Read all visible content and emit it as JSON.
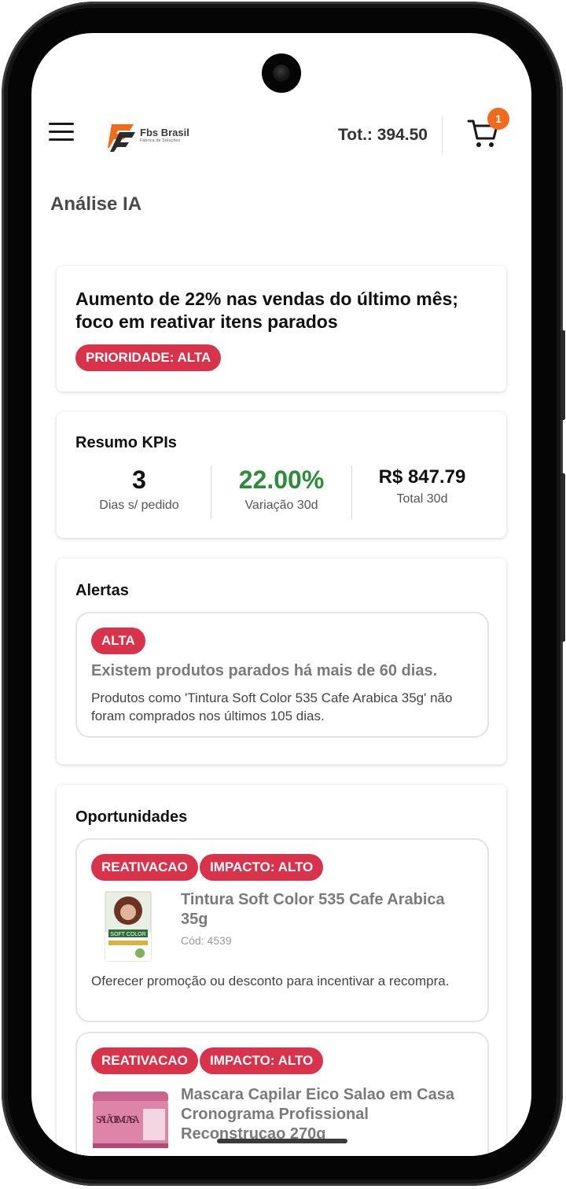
{
  "header": {
    "brand_name": "Fbs Brasil",
    "brand_tagline": "Fábrica de Soluções",
    "total_label": "Tot.: 394.50",
    "cart_badge": "1"
  },
  "page": {
    "title": "Análise IA"
  },
  "summary": {
    "headline": "Aumento de 22% nas vendas do último mês; foco em reativar itens parados",
    "priority_label": "PRIORIDADE: ALTA"
  },
  "kpis": {
    "title": "Resumo KPIs",
    "items": [
      {
        "value": "3",
        "label": "Dias s/ pedido"
      },
      {
        "value": "22.00%",
        "label": "Variação 30d"
      },
      {
        "value": "R$ 847.79",
        "label": "Total 30d"
      }
    ]
  },
  "alerts": {
    "title": "Alertas",
    "items": [
      {
        "badge": "ALTA",
        "title": "Existem produtos parados há mais de 60 dias.",
        "description": "Produtos como 'Tintura Soft Color 535 Cafe Arabica 35g' não foram comprados nos últimos 105 dias."
      }
    ]
  },
  "opportunities": {
    "title": "Oportunidades",
    "items": [
      {
        "tag": "REATIVACAO",
        "impact": "IMPACTO: ALTO",
        "name": "Tintura Soft Color 535 Cafe Arabica 35g",
        "code": "Cód: 4539",
        "description": "Oferecer promoção ou desconto para incentivar a recompra.",
        "image_text": "SOFT COLOR"
      },
      {
        "tag": "REATIVACAO",
        "impact": "IMPACTO: ALTO",
        "name": "Mascara Capilar Eico Salao em Casa Cronograma Profissional Reconstrucao 270g",
        "image_text": "SALÃO EM CASA"
      }
    ]
  },
  "colors": {
    "accent_red": "#d8334a",
    "positive_green": "#2e8b3a",
    "badge_orange": "#f26b1d"
  },
  "icons": [
    "menu-icon",
    "cart-icon",
    "logo-icon"
  ]
}
